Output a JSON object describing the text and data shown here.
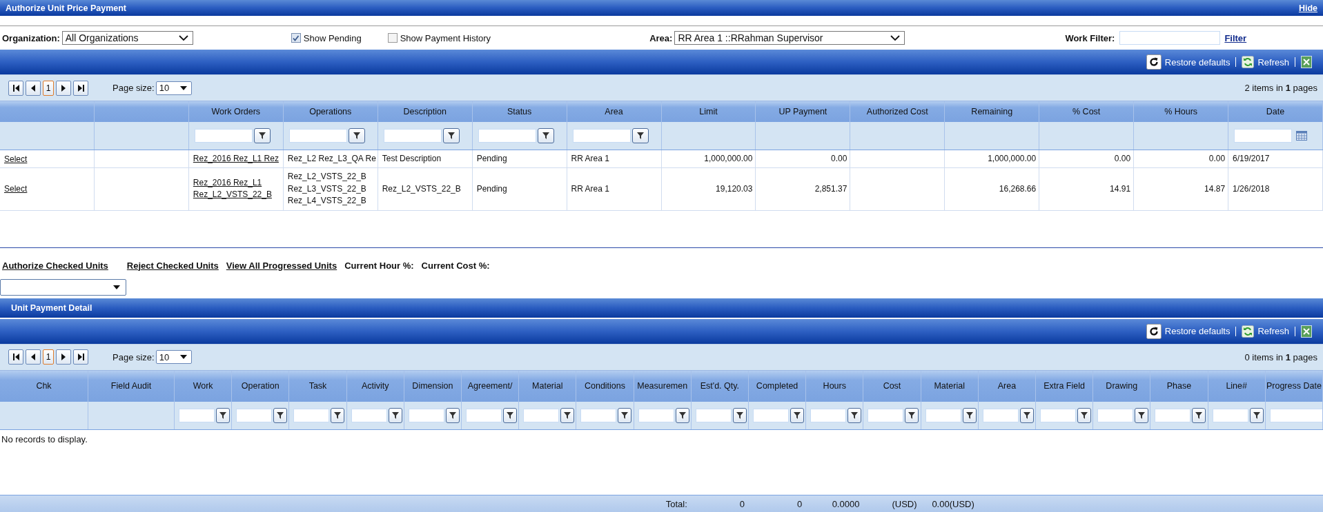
{
  "panel": {
    "title": "Authorize Unit Price Payment",
    "hide": "Hide"
  },
  "filters": {
    "organization": {
      "label": "Organization:",
      "value": "All Organizations"
    },
    "show_pending": {
      "label": "Show Pending",
      "checked": true
    },
    "show_payment_history": {
      "label": "Show Payment History",
      "checked": false
    },
    "area": {
      "label": "Area:",
      "value": "RR Area 1 ::RRahman Supervisor"
    },
    "work_filter": {
      "label": "Work Filter:",
      "button": "Filter"
    }
  },
  "work_grid": {
    "toolbar": {
      "restore": "Restore defaults",
      "refresh": "Refresh"
    },
    "pager": {
      "page": "1",
      "page_size_label": "Page size:",
      "page_size": "10",
      "summary": "2 items in **1** pages"
    },
    "columns": [
      {
        "label": "Work Orders",
        "kind": "link"
      },
      {
        "label": "Operations",
        "kind": "text"
      },
      {
        "label": "Description",
        "kind": "text"
      },
      {
        "label": "Status",
        "kind": "text"
      },
      {
        "label": "Area",
        "kind": "text"
      },
      {
        "label": "Limit",
        "kind": "number"
      },
      {
        "label": "UP Payment",
        "kind": "number"
      },
      {
        "label": "Authorized Cost",
        "kind": "number"
      },
      {
        "label": "Remaining",
        "kind": "number"
      },
      {
        "label": "% Cost",
        "kind": "number"
      },
      {
        "label": "% Hours",
        "kind": "number"
      },
      {
        "label": "Date",
        "kind": "date"
      }
    ],
    "rows": [
      {
        "select": "Select",
        "cells": [
          [
            "Rez_2016 Rez_L1 Rez"
          ],
          [
            "Rez_L2 Rez_L3_QA Re"
          ],
          [
            "Test Description"
          ],
          [
            "Pending"
          ],
          [
            "RR Area 1"
          ],
          [
            "1,000,000.00"
          ],
          [
            "0.00"
          ],
          null,
          [
            "1,000,000.00"
          ],
          [
            "0.00"
          ],
          [
            "0.00"
          ],
          [
            "6/19/2017"
          ]
        ]
      },
      {
        "select": "Select",
        "cells": [
          [
            "Rez_2016 Rez_L1",
            "Rez_L2_VSTS_22_B"
          ],
          [
            "Rez_L2_VSTS_22_B",
            "Rez_L3_VSTS_22_B",
            "Rez_L4_VSTS_22_B"
          ],
          [
            "Rez_L2_VSTS_22_B"
          ],
          [
            "Pending"
          ],
          [
            "RR Area 1"
          ],
          [
            "19,120.03"
          ],
          [
            "2,851.37"
          ],
          null,
          [
            "16,268.66"
          ],
          [
            "14.91"
          ],
          [
            "14.87"
          ],
          [
            "1/26/2018"
          ]
        ]
      }
    ]
  },
  "actions": [
    {
      "label": "Authorize Checked Units",
      "kind": "link"
    },
    {
      "label": "Reject Checked Units",
      "kind": "link"
    },
    {
      "label": "View All Progressed Units",
      "kind": "link"
    },
    {
      "label": "Current Hour %:",
      "kind": "label"
    },
    {
      "label": "Current Cost %:",
      "kind": "label"
    }
  ],
  "detail": {
    "title": "Unit Payment Detail",
    "toolbar": {
      "restore": "Restore defaults",
      "refresh": "Refresh"
    },
    "pager": {
      "page": "1",
      "page_size_label": "Page size:",
      "page_size": "10",
      "summary": "0 items in **1** pages"
    },
    "columns": [
      {
        "label": "Chk",
        "kind": "plain"
      },
      {
        "label": "Field Audit",
        "kind": "plain"
      },
      {
        "label": "Work",
        "kind": "text"
      },
      {
        "label": "Operation",
        "kind": "text"
      },
      {
        "label": "Task",
        "kind": "text"
      },
      {
        "label": "Activity",
        "kind": "text"
      },
      {
        "label": "Dimension",
        "kind": "text"
      },
      {
        "label": "Agreement/",
        "kind": "text"
      },
      {
        "label": "Material",
        "kind": "text"
      },
      {
        "label": "Conditions",
        "kind": "text"
      },
      {
        "label": "Measuremen",
        "kind": "text",
        "total": "Total:"
      },
      {
        "label": "Est'd. Qty.",
        "kind": "text",
        "total": "0"
      },
      {
        "label": "Completed",
        "kind": "text",
        "total": "0"
      },
      {
        "label": "Hours",
        "kind": "text",
        "total": "0.0000"
      },
      {
        "label": "Cost",
        "kind": "text",
        "total": "(USD)"
      },
      {
        "label": "Material",
        "kind": "text",
        "total": "0.00(USD)"
      },
      {
        "label": "Area",
        "kind": "text"
      },
      {
        "label": "Extra Field",
        "kind": "text"
      },
      {
        "label": "Drawing",
        "kind": "text"
      },
      {
        "label": "Phase",
        "kind": "text"
      },
      {
        "label": "Line#",
        "kind": "text"
      },
      {
        "label": "Progress Date",
        "kind": "date"
      }
    ],
    "empty": "No records to display."
  }
}
